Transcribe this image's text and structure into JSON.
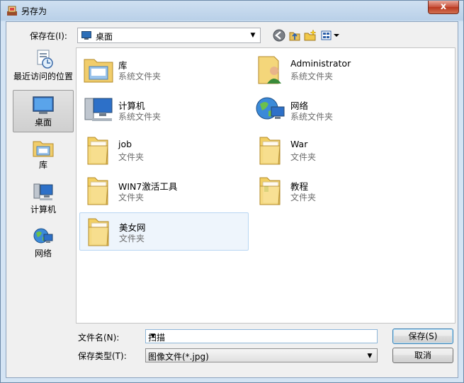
{
  "window": {
    "title": "另存为",
    "close_label": "x"
  },
  "toolbar": {
    "save_in_label": "保存在(I):",
    "location": "桌面"
  },
  "places": [
    {
      "label": "最近访问的位置",
      "icon": "recent-places-icon"
    },
    {
      "label": "桌面",
      "icon": "desktop-icon"
    },
    {
      "label": "库",
      "icon": "libraries-icon"
    },
    {
      "label": "计算机",
      "icon": "computer-icon"
    },
    {
      "label": "网络",
      "icon": "network-icon"
    }
  ],
  "files": [
    {
      "name": "库",
      "type": "系统文件夹",
      "icon": "libraries-icon"
    },
    {
      "name": "Administrator",
      "type": "系统文件夹",
      "icon": "user-folder-icon"
    },
    {
      "name": "计算机",
      "type": "系统文件夹",
      "icon": "computer-icon"
    },
    {
      "name": "网络",
      "type": "系统文件夹",
      "icon": "network-icon"
    },
    {
      "name": "job",
      "type": "文件夹",
      "icon": "folder-icon"
    },
    {
      "name": "War",
      "type": "文件夹",
      "icon": "folder-icon"
    },
    {
      "name": "WIN7激活工具",
      "type": "文件夹",
      "icon": "folder-icon"
    },
    {
      "name": "教程",
      "type": "文件夹",
      "icon": "folder-icon"
    },
    {
      "name": "美女网",
      "type": "文件夹",
      "icon": "folder-icon"
    }
  ],
  "form": {
    "filename_label": "文件名(N):",
    "filename_value": "扫描",
    "filetype_label": "保存类型(T):",
    "filetype_value": "图像文件(*.jpg)",
    "save_button": "保存(S)",
    "cancel_button": "取消"
  }
}
